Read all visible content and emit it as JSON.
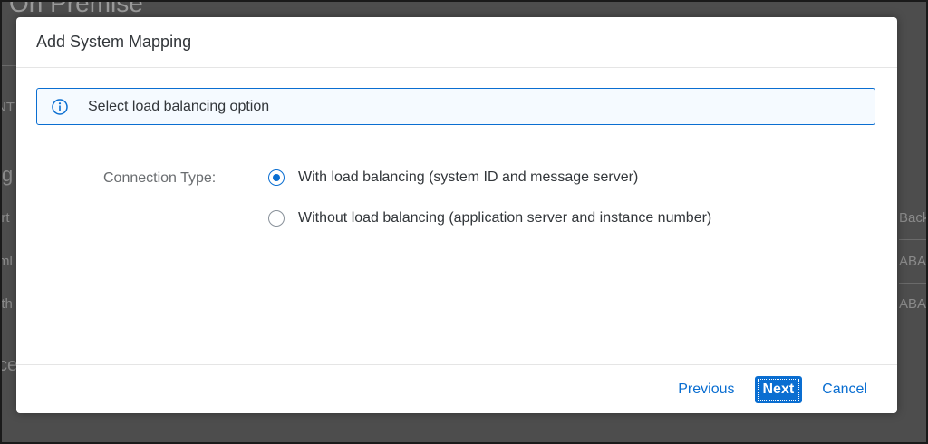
{
  "background": {
    "page_title": "On Premise",
    "left_fragments": [
      "NT",
      "g",
      "irt",
      "ml",
      "ith",
      "ce"
    ],
    "right_fragments": [
      "Back",
      "ABA",
      "ABA"
    ]
  },
  "dialog": {
    "title": "Add System Mapping",
    "info_message": "Select load balancing option",
    "connection_type_label": "Connection Type:",
    "options": [
      {
        "label": "With load balancing (system ID and message server)",
        "selected": true
      },
      {
        "label": "Without load balancing (application server and instance number)",
        "selected": false
      }
    ],
    "buttons": {
      "previous": "Previous",
      "next": "Next",
      "cancel": "Cancel"
    }
  },
  "colors": {
    "accent": "#0a6ed1",
    "info_bg": "#f5faff",
    "text": "#32363a",
    "label": "#6a6d70"
  }
}
